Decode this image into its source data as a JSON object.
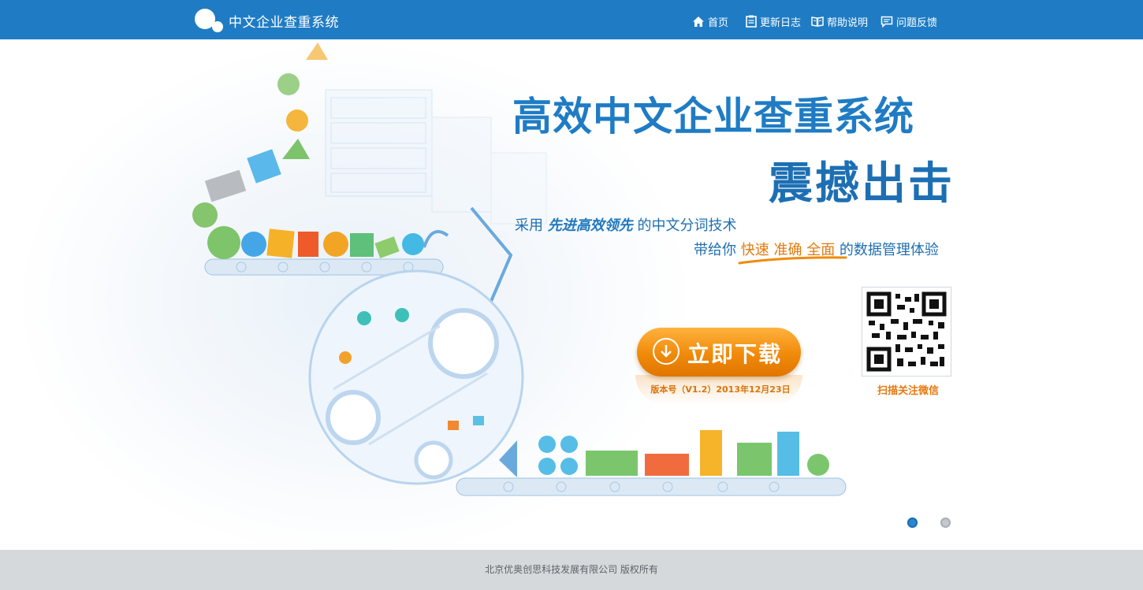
{
  "header": {
    "brand": "中文企业查重系统",
    "nav": [
      {
        "label": "首页",
        "icon": "home-icon"
      },
      {
        "label": "更新日志",
        "icon": "clipboard-icon"
      },
      {
        "label": "帮助说明",
        "icon": "book-icon"
      },
      {
        "label": "问题反馈",
        "icon": "chat-icon"
      }
    ]
  },
  "hero": {
    "title": "高效中文企业查重系统",
    "subtitle": "震撼出击",
    "line1": {
      "prefix": "采用 ",
      "emphasis": "先进高效领先",
      "suffix": " 的中文分词技术"
    },
    "line2": {
      "prefix": "带给你 ",
      "h1": "快速",
      "h2": "准确",
      "h3": "全面",
      "suffix": " 的数据管理体验"
    },
    "download_label": "立即下载",
    "version": "版本号（V1.2）2013年12月23日",
    "qr_label": "扫描关注微信"
  },
  "carousel": {
    "active_index": 0,
    "count": 2
  },
  "footer": {
    "copyright": "北京优奥创思科技发展有限公司  版权所有"
  },
  "colors": {
    "header": "#1f7cc4",
    "accent": "#f08a0a",
    "title": "#1f7cc4",
    "footer": "#d6d9dc"
  }
}
